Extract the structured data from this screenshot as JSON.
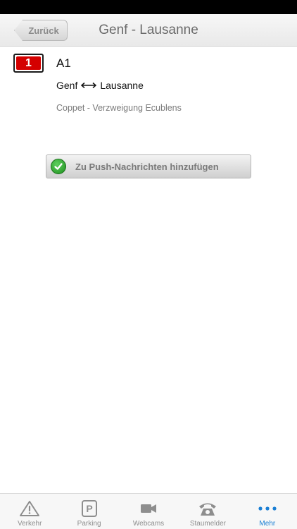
{
  "nav": {
    "back_label": "Zurück",
    "title": "Genf - Lausanne"
  },
  "road": {
    "badge_number": "1",
    "name": "A1",
    "from": "Genf",
    "to": "Lausanne",
    "section": "Coppet - Verzweigung Ecublens"
  },
  "push_button": {
    "label": "Zu Push-Nachrichten hinzufügen"
  },
  "tabs": [
    {
      "label": "Verkehr",
      "icon": "warning-triangle-icon"
    },
    {
      "label": "Parking",
      "icon": "parking-icon"
    },
    {
      "label": "Webcams",
      "icon": "video-camera-icon"
    },
    {
      "label": "Staumelder",
      "icon": "telephone-icon"
    },
    {
      "label": "Mehr",
      "icon": "more-dots-icon",
      "active": true
    }
  ],
  "colors": {
    "badge_red": "#d40000",
    "accent_blue": "#1a7fd4",
    "check_green": "#2ea52e"
  }
}
